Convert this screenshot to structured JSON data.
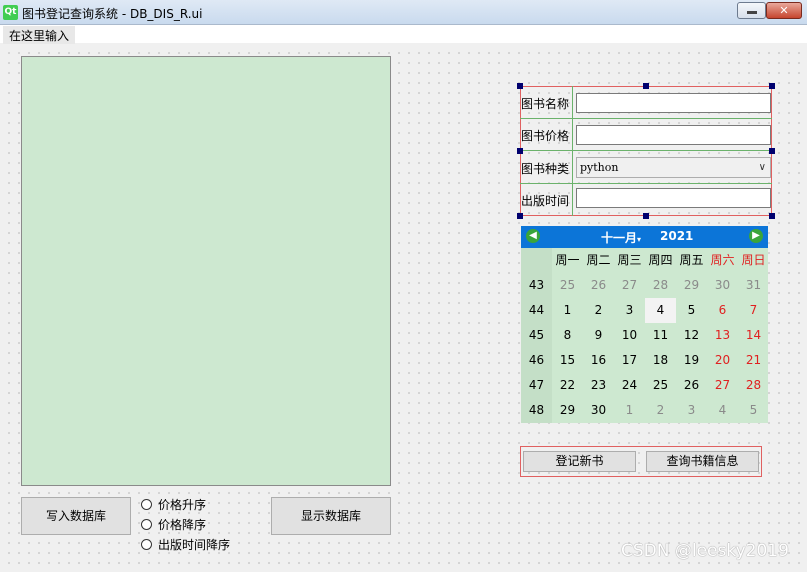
{
  "window": {
    "title": "图书登记查询系统 - DB_DIS_R.ui",
    "logo_text": "Qt",
    "close_glyph": "✕"
  },
  "menubar": {
    "placeholder_item": "在这里输入"
  },
  "left": {
    "write_db_button": "写入数据库",
    "show_db_button": "显示数据库",
    "radios": [
      "价格升序",
      "价格降序",
      "出版时间降序"
    ]
  },
  "form": {
    "labels": [
      "图书名称",
      "图书价格",
      "图书种类",
      "出版时间"
    ],
    "book_type_value": "python",
    "book_name_value": "",
    "book_price_value": "",
    "publish_time_value": ""
  },
  "calendar": {
    "month": "十一月",
    "year": "2021",
    "weekday_headers": [
      "周一",
      "周二",
      "周三",
      "周四",
      "周五",
      "周六",
      "周日"
    ],
    "week_numbers": [
      "43",
      "44",
      "45",
      "46",
      "47",
      "48"
    ],
    "days": [
      [
        "25",
        "26",
        "27",
        "28",
        "29",
        "30",
        "31"
      ],
      [
        "1",
        "2",
        "3",
        "4",
        "5",
        "6",
        "7"
      ],
      [
        "8",
        "9",
        "10",
        "11",
        "12",
        "13",
        "14"
      ],
      [
        "15",
        "16",
        "17",
        "18",
        "19",
        "20",
        "21"
      ],
      [
        "22",
        "23",
        "24",
        "25",
        "26",
        "27",
        "28"
      ],
      [
        "29",
        "30",
        "1",
        "2",
        "3",
        "4",
        "5"
      ]
    ],
    "selected_day": "4",
    "colors": {
      "header_bg": "#0c75d8",
      "weekend": "#e02020",
      "other_month": "#8a8a8a",
      "body_bg": "#cde8d0"
    }
  },
  "actions": {
    "register_button": "登记新书",
    "query_button": "查询书籍信息"
  },
  "watermark": "CSDN @leesky2019"
}
